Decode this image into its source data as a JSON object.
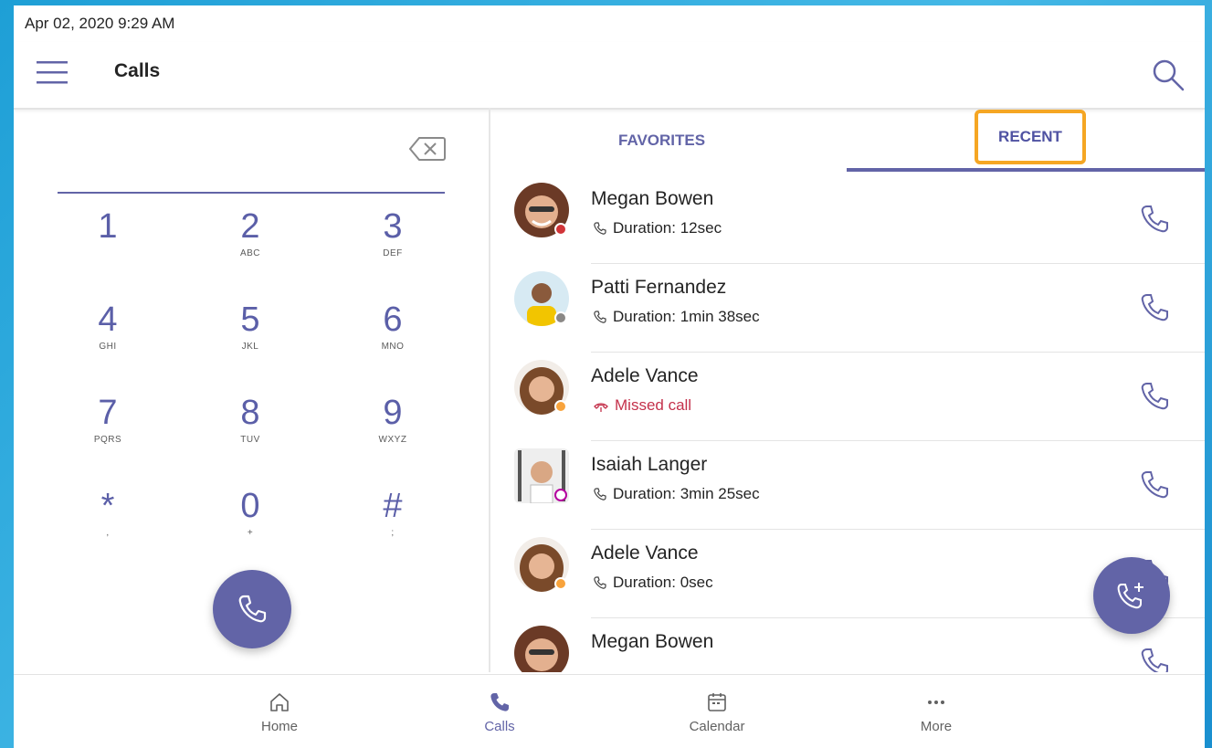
{
  "status": {
    "datetime": "Apr 02, 2020  9:29 AM"
  },
  "header": {
    "title": "Calls"
  },
  "dialer": {
    "keys": [
      {
        "digit": "1",
        "letters": ""
      },
      {
        "digit": "2",
        "letters": "ABC"
      },
      {
        "digit": "3",
        "letters": "DEF"
      },
      {
        "digit": "4",
        "letters": "GHI"
      },
      {
        "digit": "5",
        "letters": "JKL"
      },
      {
        "digit": "6",
        "letters": "MNO"
      },
      {
        "digit": "7",
        "letters": "PQRS"
      },
      {
        "digit": "8",
        "letters": "TUV"
      },
      {
        "digit": "9",
        "letters": "WXYZ"
      },
      {
        "digit": "*",
        "letters": ","
      },
      {
        "digit": "0",
        "letters": "+"
      },
      {
        "digit": "#",
        "letters": ";"
      }
    ]
  },
  "tabs": {
    "favorites": "FAVORITES",
    "recent": "RECENT"
  },
  "calls": [
    {
      "name": "Megan Bowen",
      "detail": "Duration: 12sec",
      "missed": false,
      "presence": "#d13438"
    },
    {
      "name": "Patti Fernandez",
      "detail": "Duration: 1min 38sec",
      "missed": false,
      "presence": "#8a8886"
    },
    {
      "name": "Adele Vance",
      "detail": "Missed call",
      "missed": true,
      "presence": "#f8a33c"
    },
    {
      "name": "Isaiah Langer",
      "detail": "Duration: 3min 25sec",
      "missed": false,
      "presence": "#b4009e"
    },
    {
      "name": "Adele Vance",
      "detail": "Duration: 0sec",
      "missed": false,
      "presence": "#f8a33c"
    },
    {
      "name": "Megan Bowen",
      "detail": "",
      "missed": false,
      "presence": "#d13438"
    }
  ],
  "nav": {
    "home": "Home",
    "calls": "Calls",
    "calendar": "Calendar",
    "more": "More"
  },
  "colors": {
    "accent": "#6264a7",
    "missed": "#c4314b",
    "highlight": "#f5a623"
  }
}
